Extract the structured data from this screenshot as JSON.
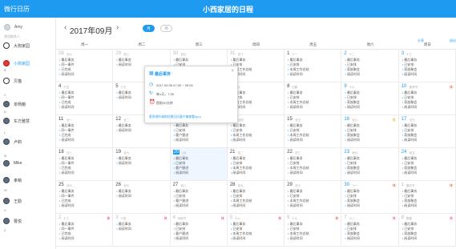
{
  "app": {
    "logo": "微行日历",
    "title": "小西家居的日程"
  },
  "sidebar": {
    "me": "Amy",
    "section": "常用联系人",
    "contacts": [
      {
        "name": "大狗家园",
        "icon": "panda-avatar"
      },
      {
        "name": "小狗家园",
        "icon": "red-panda-avatar",
        "active": true
      },
      {
        "name": "贝猫",
        "icon": "panda-avatar"
      },
      {
        "name": "单杨棚",
        "icon": "person-avatar"
      },
      {
        "name": "东方雅慧",
        "icon": "person-avatar"
      },
      {
        "name": "卢莉",
        "icon": "person-avatar"
      },
      {
        "name": "Mike",
        "icon": "person-avatar"
      },
      {
        "name": "孝萌",
        "icon": "person-avatar"
      },
      {
        "name": "王勤",
        "icon": "person-avatar"
      },
      {
        "name": "曹悦",
        "icon": "person-avatar"
      }
    ],
    "letters": [
      "B",
      "C",
      "D",
      "L",
      "M",
      "W",
      "X",
      "Z"
    ]
  },
  "header": {
    "prev": "‹",
    "month": "2017年09月",
    "next": "›",
    "view_month": "月",
    "view_week": "周",
    "share": "分享",
    "exit": "退出"
  },
  "weekdays": [
    "周一",
    "周二",
    "周三",
    "周四",
    "周五",
    "周六",
    "周日"
  ],
  "events": {
    "a": [
      "最后事务",
      "同一事件",
      "已完成",
      "阅读时间"
    ],
    "b": [
      "最后事务",
      "阅读时间"
    ],
    "c": [
      "最后事务",
      "已安排",
      "客户跟进",
      "阅读时间"
    ],
    "d": [
      "最后事务",
      "已安排",
      "本周工作总结",
      "阅读时间"
    ],
    "e": [
      "最后事务",
      "已安排",
      "家族聚会",
      "阅读时间"
    ]
  },
  "weeks": [
    {
      "days": [
        {
          "n": "28",
          "l": "廿九"
        },
        {
          "n": "29",
          "l": "初八"
        },
        {
          "n": "30",
          "l": "初九"
        },
        {
          "n": "31",
          "l": "初十"
        },
        {
          "n": "1",
          "l": "十一"
        },
        {
          "n": "2",
          "l": "十二"
        },
        {
          "n": "3",
          "l": "十三"
        }
      ]
    },
    {
      "days": [
        {
          "n": "4",
          "l": "十四"
        },
        {
          "n": "5",
          "l": "十五"
        },
        {
          "n": "6",
          "l": "十六"
        },
        {
          "n": "7",
          "l": "十七"
        },
        {
          "n": "8",
          "l": "白露"
        },
        {
          "n": "9",
          "l": "十九"
        },
        {
          "n": "10",
          "l": "教师节"
        }
      ]
    },
    {
      "days": [
        {
          "n": "11",
          "l": "廿一"
        },
        {
          "n": "12",
          "l": "廿二"
        },
        {
          "n": "13",
          "l": "廿三"
        },
        {
          "n": "14",
          "l": "廿四"
        },
        {
          "n": "15",
          "l": "廿五"
        },
        {
          "n": "16",
          "l": "廿六"
        },
        {
          "n": "17",
          "l": "廿七"
        }
      ]
    },
    {
      "days": [
        {
          "n": "18",
          "l": "廿八"
        },
        {
          "n": "19",
          "l": "廿九"
        },
        {
          "n": "20",
          "l": "八月"
        },
        {
          "n": "21",
          "l": "初二"
        },
        {
          "n": "22",
          "l": "初三"
        },
        {
          "n": "23",
          "l": "秋分"
        },
        {
          "n": "24",
          "l": "初五"
        }
      ]
    },
    {
      "days": [
        {
          "n": "25",
          "l": "初六"
        },
        {
          "n": "26",
          "l": "初七"
        },
        {
          "n": "27",
          "l": "初八"
        },
        {
          "n": "28",
          "l": "初九"
        },
        {
          "n": "29",
          "l": "初十"
        },
        {
          "n": "30",
          "l": "十一"
        },
        {
          "n": "1",
          "l": "国庆节"
        }
      ]
    },
    {
      "days": [
        {
          "n": "2",
          "l": "十三"
        },
        {
          "n": "3",
          "l": "十四"
        },
        {
          "n": "4",
          "l": "中秋节"
        },
        {
          "n": "5",
          "l": "十六"
        },
        {
          "n": "6",
          "l": "十七"
        },
        {
          "n": "7",
          "l": "十八"
        },
        {
          "n": "8",
          "l": "寒露"
        }
      ]
    }
  ],
  "tags": {
    "rest": "休",
    "work": "班"
  },
  "popup": {
    "title": "最后事务",
    "time": "2017.09.05 07:00 ~ 09:00",
    "repeat": "每1天，7:30",
    "remind": "提前30分钟",
    "link": "更多细节请前往微日历客户端查看Ap p"
  }
}
